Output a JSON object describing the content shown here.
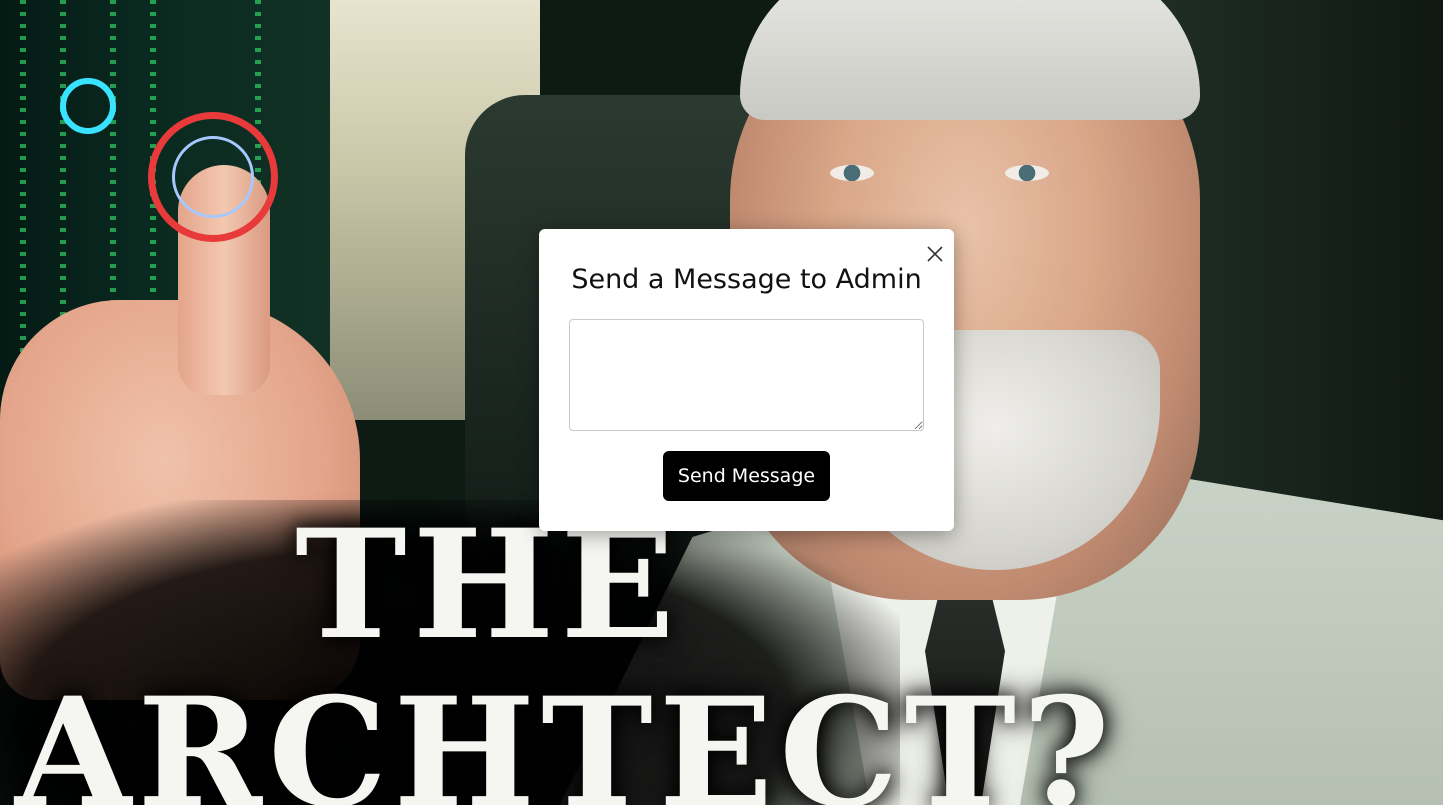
{
  "background": {
    "title_line_1": "THE",
    "title_line_2": "ARCHTECT?"
  },
  "modal": {
    "title": "Send a Message to Admin",
    "message_value": "",
    "message_placeholder": "",
    "send_label": "Send Message",
    "close_icon": "close-icon"
  },
  "colors": {
    "modal_bg": "#ffffff",
    "send_button_bg": "#000000",
    "send_button_text": "#ffffff"
  }
}
